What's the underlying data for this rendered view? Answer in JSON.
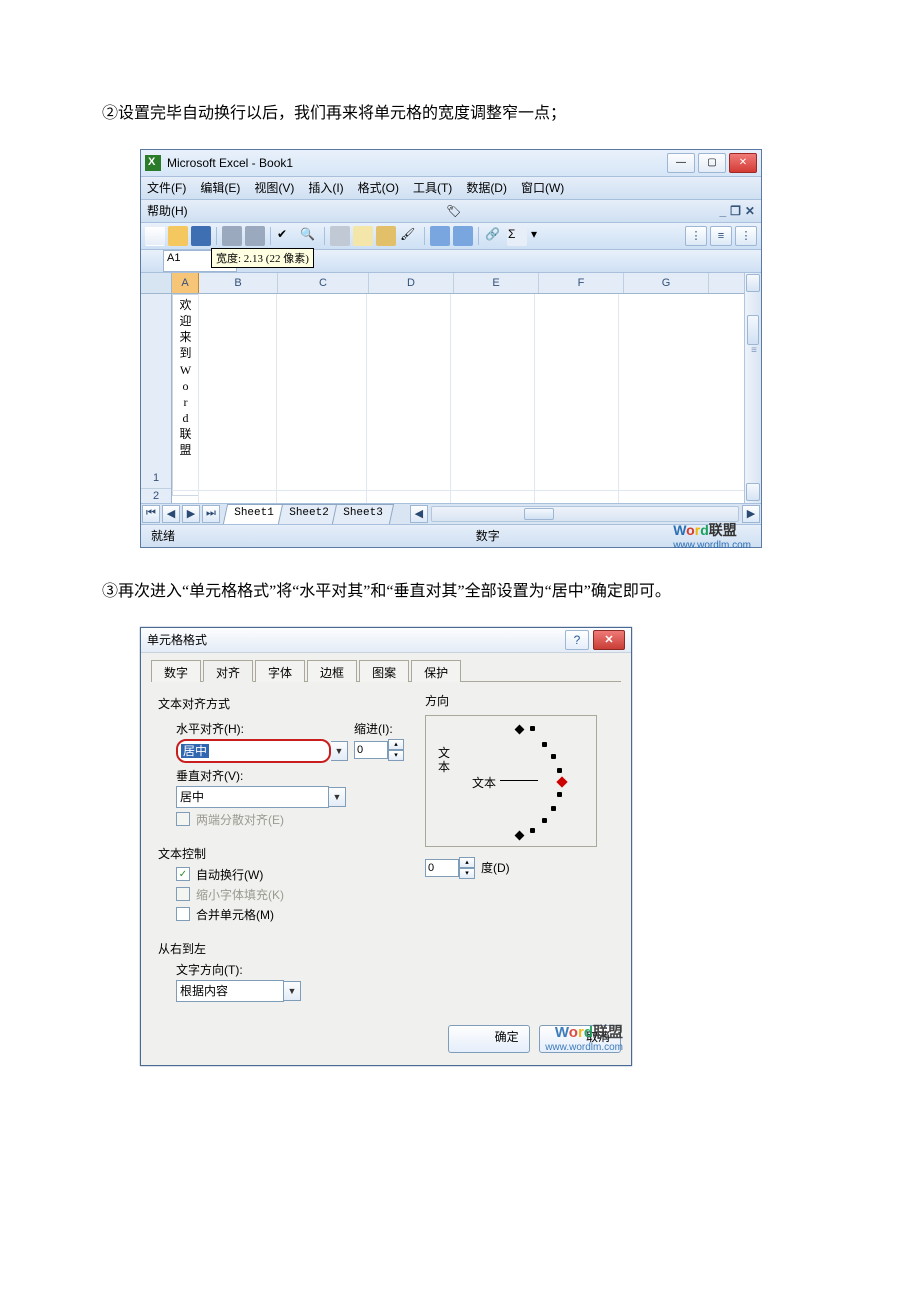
{
  "para1": "②设置完毕自动换行以后，我们再来将单元格的宽度调整窄一点；",
  "para2": "③再次进入“单元格格式”将“水平对其”和“垂直对其”全部设置为“居中”确定即可。",
  "excel": {
    "title": "Microsoft Excel - Book1",
    "menus": [
      "文件(F)",
      "编辑(E)",
      "视图(V)",
      "插入(I)",
      "格式(O)",
      "工具(T)",
      "数据(D)",
      "窗口(W)"
    ],
    "help": "帮助(H)",
    "tooltip": "宽度: 2.13 (22 像素)",
    "namebox": "A1",
    "cols": [
      "A",
      "B",
      "C",
      "D",
      "E",
      "F",
      "G"
    ],
    "cellA1": "欢\n迎\n来\n到\nW\no\nr\nd\n联\n盟",
    "row1": "1",
    "row2": "2",
    "sheets": [
      "Sheet1",
      "Sheet2",
      "Sheet3"
    ],
    "status_left": "就绪",
    "status_mid": "数字",
    "wm_text": "Word联盟",
    "wm_url": "www.wordlm.com"
  },
  "dlg": {
    "title": "单元格格式",
    "tabs": [
      "数字",
      "对齐",
      "字体",
      "边框",
      "图案",
      "保护"
    ],
    "active_tab": 1,
    "grp_align": "文本对齐方式",
    "lbl_h": "水平对齐(H):",
    "val_h": "居中",
    "lbl_indent": "缩进(I):",
    "val_indent": "0",
    "lbl_v": "垂直对齐(V):",
    "val_v": "居中",
    "chk_justify": "两端分散对齐(E)",
    "grp_ctrl": "文本控制",
    "chk_wrap": "自动换行(W)",
    "chk_shrink": "缩小字体填充(K)",
    "chk_merge": "合并单元格(M)",
    "grp_rtl": "从右到左",
    "lbl_dir": "文字方向(T):",
    "val_dir": "根据内容",
    "grp_orient": "方向",
    "orient_v": "文本",
    "orient_h": "文本",
    "val_deg": "0",
    "lbl_deg": "度(D)",
    "btn_ok": "确定",
    "btn_cancel": "取消",
    "wm_text": "Word联盟",
    "wm_url": "www.wordlm.com"
  }
}
